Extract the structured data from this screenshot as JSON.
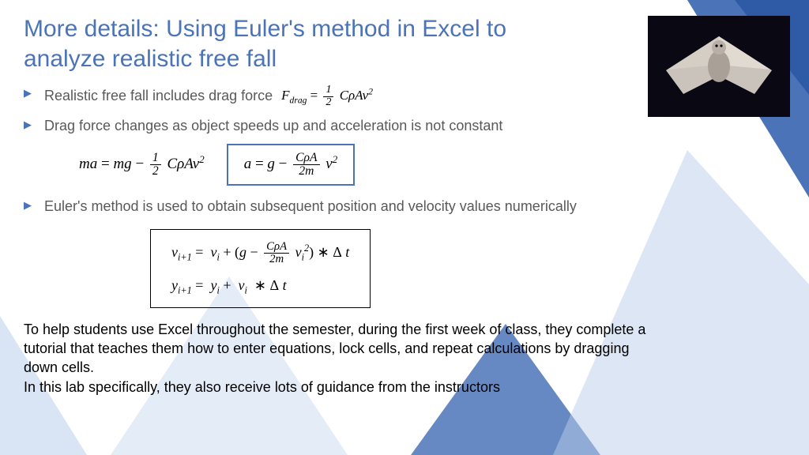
{
  "title": "More details: Using Euler's method in Excel to analyze realistic free fall",
  "bullets": {
    "b1": "Realistic free fall includes drag force",
    "b2": "Drag force changes as object speeds up and acceleration is not constant",
    "b3": "Euler's method is used to obtain subsequent position and velocity values numerically"
  },
  "equations": {
    "drag_force": "F_drag = (1/2) C ρ A v^2",
    "newton": "m a = m g − (1/2) C ρ A v^2",
    "accel": "a = g − (CρA / 2m) v^2",
    "euler_v": "v_{i+1} = v_i + (g − (CρA / 2m) v_i^2) * Δt",
    "euler_y": "y_{i+1} = y_i + v_i * Δt"
  },
  "paragraphs": {
    "p1": "To help students use Excel throughout the semester, during the first week of class, they complete a tutorial that teaches them how to enter equations, lock cells, and repeat calculations by dragging down cells.",
    "p2": "In this lab specifically, they also receive lots of guidance from the instructors"
  },
  "image": {
    "alt": "flying-squirrel-photo"
  }
}
